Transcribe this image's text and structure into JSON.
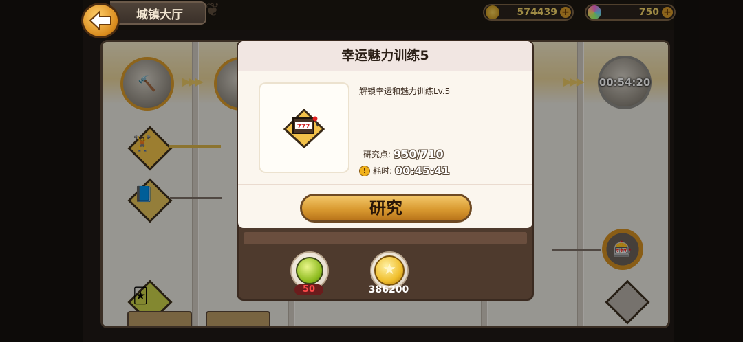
{
  "header": {
    "title": "城镇大厅",
    "back_icon": "back-arrow-icon"
  },
  "resources": {
    "gold": "574439",
    "gems": "750"
  },
  "tree": {
    "timer": "00:54:20"
  },
  "dialog": {
    "title": "幸运魅力训练5",
    "description": "解锁幸运和魅力训练Lv.5",
    "points_label": "研究点:",
    "points_value": "950/710",
    "time_label": "耗时:",
    "time_value": "00:45:41",
    "research_button": "研究"
  },
  "costs": {
    "potion_amount": "50",
    "gold_amount": "386200"
  },
  "colors": {
    "accent": "#d99a30",
    "insufficient": "#ff4a4a"
  }
}
